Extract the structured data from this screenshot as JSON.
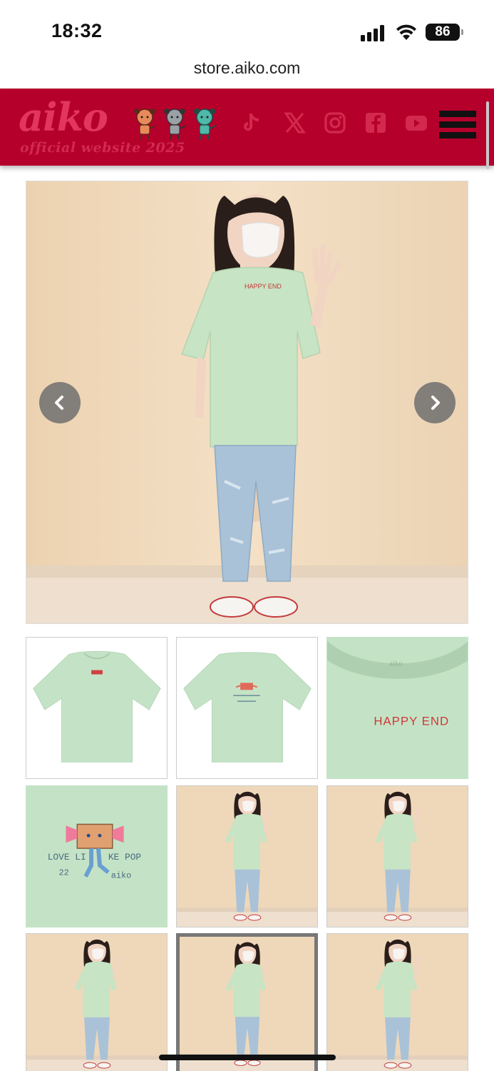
{
  "status_bar": {
    "time": "18:32",
    "battery": "86"
  },
  "browser": {
    "url": "store.aiko.com"
  },
  "header": {
    "logo": "aiko",
    "subtitle": "official website 2025",
    "brand_color": "#b5002c",
    "social_icons": [
      "tiktok-icon",
      "x-icon",
      "instagram-icon",
      "facebook-icon",
      "youtube-icon"
    ],
    "menu_icon": "hamburger-menu-icon"
  },
  "gallery": {
    "main_image": "model wearing mint green t-shirt",
    "prev_icon": "chevron-left-icon",
    "next_icon": "chevron-right-icon",
    "thumbnails": [
      "t-shirt front",
      "t-shirt back",
      "collar print detail",
      "back print detail",
      "model photo 1",
      "model photo 2",
      "model photo 3",
      "model photo 4",
      "model photo 5"
    ],
    "selected_thumbnail_index": 7,
    "collar_print_text": "HAPPY END",
    "collar_label_text": "aiko",
    "back_print_text_1": "LOVE LI",
    "back_print_text_2": "KE POP",
    "back_print_text_3": "22",
    "back_print_text_4": "aiko",
    "shirt_color": "#c4e3c6"
  }
}
